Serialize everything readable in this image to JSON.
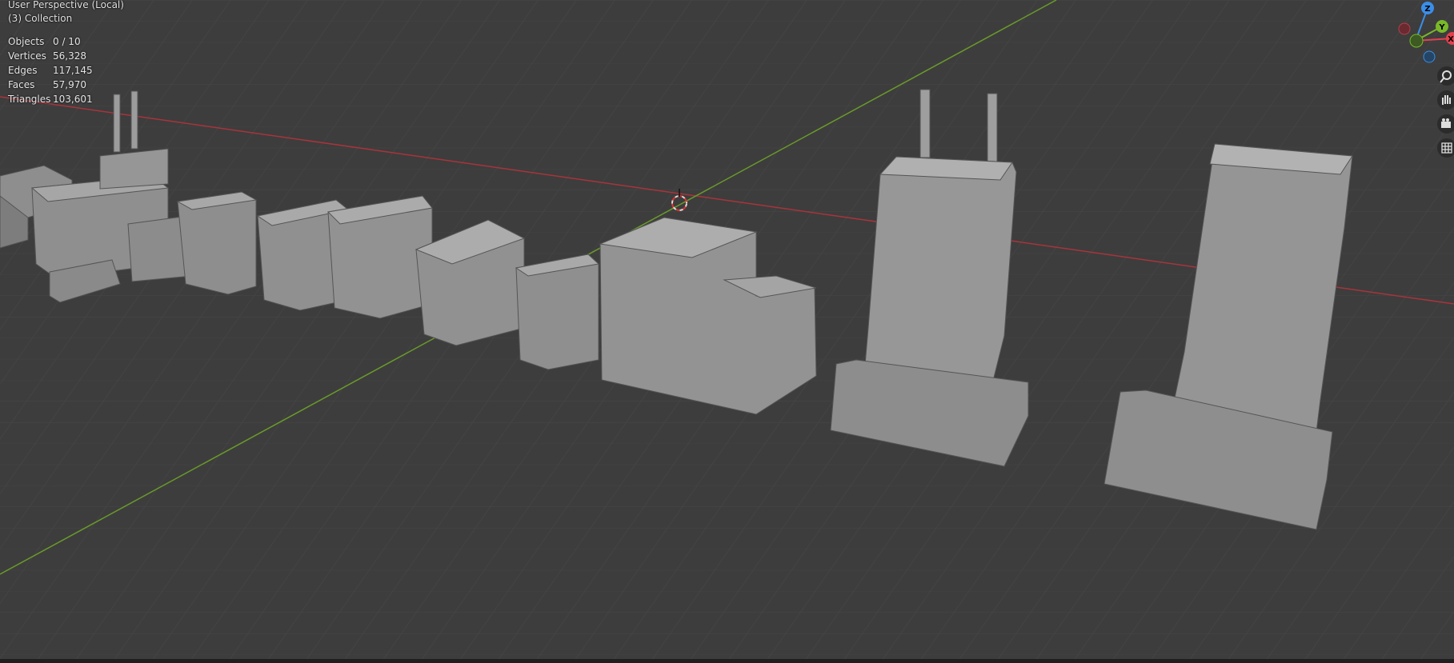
{
  "viewport": {
    "mode_label": "User Perspective (Local)",
    "collection_label": "(3) Collection"
  },
  "stats": [
    {
      "label": "Objects",
      "value": "0 / 10"
    },
    {
      "label": "Vertices",
      "value": "56,328"
    },
    {
      "label": "Edges",
      "value": "117,145"
    },
    {
      "label": "Faces",
      "value": "57,970"
    },
    {
      "label": "Triangles",
      "value": "103,601"
    }
  ],
  "gizmo": {
    "z_label": "Z",
    "y_label": "Y",
    "x_label": "X",
    "colors": {
      "x": "#e5404f",
      "y": "#7ab82a",
      "z": "#3a8ee8"
    }
  },
  "nav_icons": [
    "zoom-icon",
    "hand-pan-icon",
    "camera-icon",
    "grid-ortho-icon"
  ],
  "colors": {
    "background": "#3d3d3d",
    "grid": "#4a4a4a",
    "x_axis": "#a8343c",
    "y_axis": "#6a9a2a",
    "model": "#9a9a9a"
  }
}
